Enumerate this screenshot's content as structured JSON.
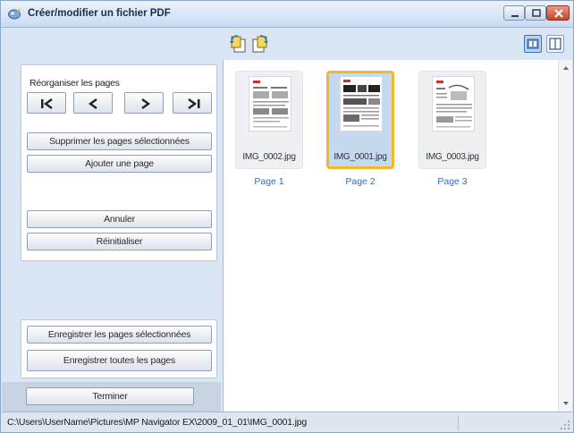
{
  "window": {
    "title": "Créer/modifier un fichier PDF"
  },
  "toolbar": {
    "rotate_left_icon": "rotate-left-icon",
    "rotate_right_icon": "rotate-right-icon",
    "view_thumbnails_icon": "thumbnail-view-icon",
    "view_page_icon": "page-view-icon"
  },
  "left_panel": {
    "reorder_label": "Réorganiser les pages",
    "nav_buttons": [
      "first-page",
      "previous-page",
      "next-page",
      "last-page"
    ],
    "delete_selected": "Supprimer les pages sélectionnées",
    "add_page": "Ajouter une page",
    "undo": "Annuler",
    "reset": "Réinitialiser",
    "save_selected": "Enregistrer les pages sélectionnées",
    "save_all": "Enregistrer toutes les pages",
    "finish": "Terminer"
  },
  "pages": [
    {
      "filename": "IMG_0002.jpg",
      "label": "Page 1",
      "selected": false
    },
    {
      "filename": "IMG_0001.jpg",
      "label": "Page 2",
      "selected": true
    },
    {
      "filename": "IMG_0003.jpg",
      "label": "Page 3",
      "selected": false
    }
  ],
  "status_bar": {
    "path": "C:\\Users\\UserName\\Pictures\\MP Navigator EX\\2009_01_01\\IMG_0001.jpg"
  },
  "colors": {
    "accent": "#2a6ed6",
    "selection": "#f3b82a",
    "panel": "#dbe6f4"
  }
}
